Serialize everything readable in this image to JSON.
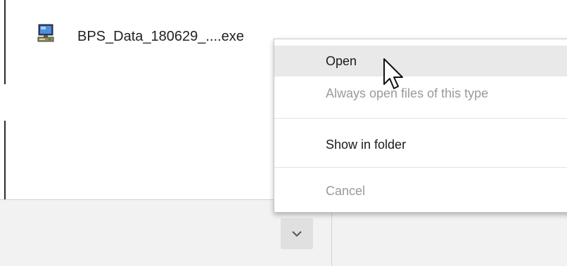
{
  "context_menu": {
    "items": [
      {
        "label": "Open",
        "enabled": true,
        "highlighted": true
      },
      {
        "label": "Always open files of this type",
        "enabled": false
      },
      {
        "label": "Show in folder",
        "enabled": true
      },
      {
        "label": "Cancel",
        "enabled": false
      }
    ]
  },
  "download_shelf": {
    "file_name": "BPS_Data_180629_....exe",
    "file_icon": "installer-computer-icon",
    "menu_toggle_icon": "chevron-down-icon"
  },
  "cursor": {
    "icon": "mouse-pointer-icon"
  },
  "colors": {
    "menu_hover": "#e9e9e9",
    "disabled_text": "#9a9a9a",
    "shelf_background": "#f2f2f2"
  }
}
